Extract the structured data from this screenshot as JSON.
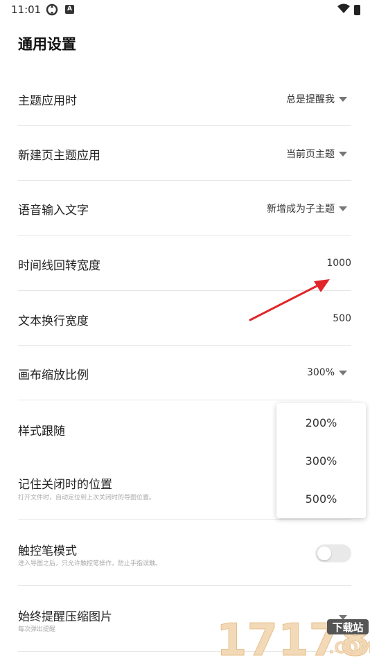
{
  "status_bar": {
    "time": "11:01",
    "icons": [
      "sync-icon",
      "a-notification-icon",
      "wifi-icon",
      "battery-icon"
    ]
  },
  "page": {
    "title": "通用设置"
  },
  "settings": [
    {
      "label": "主题应用时",
      "value": "总是提醒我",
      "has_dropdown": true
    },
    {
      "label": "新建页主题应用",
      "value": "当前页主题",
      "has_dropdown": true
    },
    {
      "label": "语音输入文字",
      "value": "新增成为子主题",
      "has_dropdown": true
    },
    {
      "label": "时间线回转宽度",
      "value": "1000"
    },
    {
      "label": "文本换行宽度",
      "value": "500"
    },
    {
      "label": "画布缩放比例",
      "value": "300%",
      "has_dropdown": true
    },
    {
      "label": "样式跟随"
    },
    {
      "label": "记住关闭时的位置",
      "sub": "打开文件时，自动定位到上次关闭时的导图位置。"
    },
    {
      "label": "触控笔模式",
      "sub": "进入导图之后，只允许触控笔操作，防止手指误触。",
      "toggle": false
    },
    {
      "label": "始终提醒压缩图片",
      "sub": "每次弹出提醒"
    }
  ],
  "dropdown": {
    "options": [
      "200%",
      "300%",
      "500%"
    ]
  },
  "annotation": {
    "arrow_color": "#e0262a"
  },
  "watermark": {
    "site": "17178",
    "badge": "下载站",
    "suffix": ".COM"
  }
}
